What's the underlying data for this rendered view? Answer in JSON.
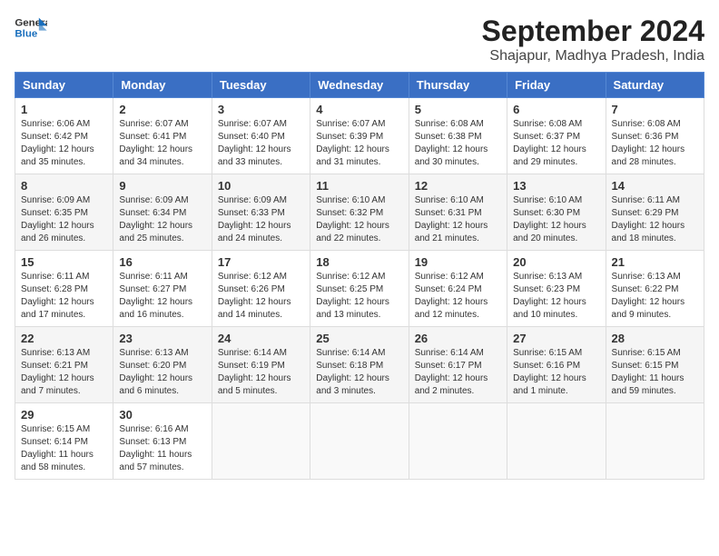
{
  "logo": {
    "line1": "General",
    "line2": "Blue"
  },
  "title": "September 2024",
  "subtitle": "Shajapur, Madhya Pradesh, India",
  "weekdays": [
    "Sunday",
    "Monday",
    "Tuesday",
    "Wednesday",
    "Thursday",
    "Friday",
    "Saturday"
  ],
  "weeks": [
    [
      {
        "day": "1",
        "sunrise": "6:06 AM",
        "sunset": "6:42 PM",
        "daylight": "12 hours and 35 minutes."
      },
      {
        "day": "2",
        "sunrise": "6:07 AM",
        "sunset": "6:41 PM",
        "daylight": "12 hours and 34 minutes."
      },
      {
        "day": "3",
        "sunrise": "6:07 AM",
        "sunset": "6:40 PM",
        "daylight": "12 hours and 33 minutes."
      },
      {
        "day": "4",
        "sunrise": "6:07 AM",
        "sunset": "6:39 PM",
        "daylight": "12 hours and 31 minutes."
      },
      {
        "day": "5",
        "sunrise": "6:08 AM",
        "sunset": "6:38 PM",
        "daylight": "12 hours and 30 minutes."
      },
      {
        "day": "6",
        "sunrise": "6:08 AM",
        "sunset": "6:37 PM",
        "daylight": "12 hours and 29 minutes."
      },
      {
        "day": "7",
        "sunrise": "6:08 AM",
        "sunset": "6:36 PM",
        "daylight": "12 hours and 28 minutes."
      }
    ],
    [
      {
        "day": "8",
        "sunrise": "6:09 AM",
        "sunset": "6:35 PM",
        "daylight": "12 hours and 26 minutes."
      },
      {
        "day": "9",
        "sunrise": "6:09 AM",
        "sunset": "6:34 PM",
        "daylight": "12 hours and 25 minutes."
      },
      {
        "day": "10",
        "sunrise": "6:09 AM",
        "sunset": "6:33 PM",
        "daylight": "12 hours and 24 minutes."
      },
      {
        "day": "11",
        "sunrise": "6:10 AM",
        "sunset": "6:32 PM",
        "daylight": "12 hours and 22 minutes."
      },
      {
        "day": "12",
        "sunrise": "6:10 AM",
        "sunset": "6:31 PM",
        "daylight": "12 hours and 21 minutes."
      },
      {
        "day": "13",
        "sunrise": "6:10 AM",
        "sunset": "6:30 PM",
        "daylight": "12 hours and 20 minutes."
      },
      {
        "day": "14",
        "sunrise": "6:11 AM",
        "sunset": "6:29 PM",
        "daylight": "12 hours and 18 minutes."
      }
    ],
    [
      {
        "day": "15",
        "sunrise": "6:11 AM",
        "sunset": "6:28 PM",
        "daylight": "12 hours and 17 minutes."
      },
      {
        "day": "16",
        "sunrise": "6:11 AM",
        "sunset": "6:27 PM",
        "daylight": "12 hours and 16 minutes."
      },
      {
        "day": "17",
        "sunrise": "6:12 AM",
        "sunset": "6:26 PM",
        "daylight": "12 hours and 14 minutes."
      },
      {
        "day": "18",
        "sunrise": "6:12 AM",
        "sunset": "6:25 PM",
        "daylight": "12 hours and 13 minutes."
      },
      {
        "day": "19",
        "sunrise": "6:12 AM",
        "sunset": "6:24 PM",
        "daylight": "12 hours and 12 minutes."
      },
      {
        "day": "20",
        "sunrise": "6:13 AM",
        "sunset": "6:23 PM",
        "daylight": "12 hours and 10 minutes."
      },
      {
        "day": "21",
        "sunrise": "6:13 AM",
        "sunset": "6:22 PM",
        "daylight": "12 hours and 9 minutes."
      }
    ],
    [
      {
        "day": "22",
        "sunrise": "6:13 AM",
        "sunset": "6:21 PM",
        "daylight": "12 hours and 7 minutes."
      },
      {
        "day": "23",
        "sunrise": "6:13 AM",
        "sunset": "6:20 PM",
        "daylight": "12 hours and 6 minutes."
      },
      {
        "day": "24",
        "sunrise": "6:14 AM",
        "sunset": "6:19 PM",
        "daylight": "12 hours and 5 minutes."
      },
      {
        "day": "25",
        "sunrise": "6:14 AM",
        "sunset": "6:18 PM",
        "daylight": "12 hours and 3 minutes."
      },
      {
        "day": "26",
        "sunrise": "6:14 AM",
        "sunset": "6:17 PM",
        "daylight": "12 hours and 2 minutes."
      },
      {
        "day": "27",
        "sunrise": "6:15 AM",
        "sunset": "6:16 PM",
        "daylight": "12 hours and 1 minute."
      },
      {
        "day": "28",
        "sunrise": "6:15 AM",
        "sunset": "6:15 PM",
        "daylight": "11 hours and 59 minutes."
      }
    ],
    [
      {
        "day": "29",
        "sunrise": "6:15 AM",
        "sunset": "6:14 PM",
        "daylight": "11 hours and 58 minutes."
      },
      {
        "day": "30",
        "sunrise": "6:16 AM",
        "sunset": "6:13 PM",
        "daylight": "11 hours and 57 minutes."
      },
      null,
      null,
      null,
      null,
      null
    ]
  ]
}
